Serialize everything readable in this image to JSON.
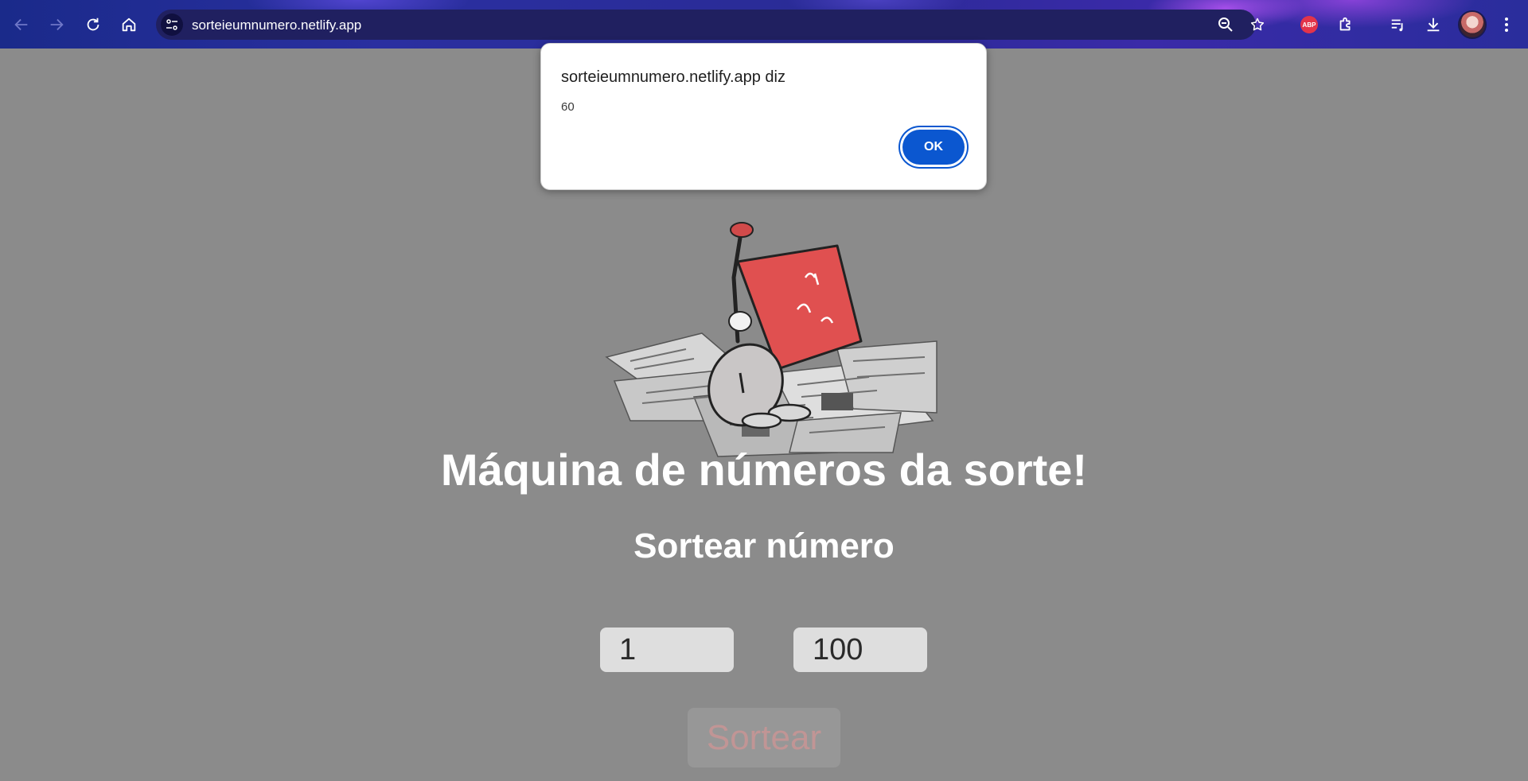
{
  "browser": {
    "url": "sorteieumnumero.netlify.app",
    "icons": {
      "back": "arrow-left-icon",
      "forward": "arrow-right-icon",
      "reload": "reload-icon",
      "home": "home-icon",
      "site_info": "site-settings-icon",
      "zoom": "zoom-out-icon",
      "bookmark": "star-icon",
      "adblock": "abp-extension-icon",
      "extensions": "puzzle-icon",
      "media": "playlist-icon",
      "downloads": "download-icon",
      "profile": "avatar",
      "menu": "kebab-menu-icon"
    },
    "extension_badge": "ABP"
  },
  "dialog": {
    "title": "sorteieumnumero.netlify.app diz",
    "message": "60",
    "ok_label": "OK"
  },
  "page": {
    "title": "Máquina de números da sorte!",
    "subtitle": "Sortear número",
    "min_value": "1",
    "max_value": "100",
    "button_label": "Sortear"
  },
  "colors": {
    "page_background": "#8b8b8b",
    "dialog_button": "#0b57d0",
    "input_background": "#dedede"
  }
}
